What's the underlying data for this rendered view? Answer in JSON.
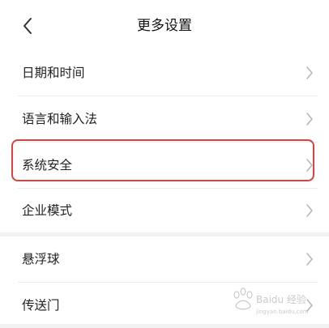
{
  "header": {
    "title": "更多设置",
    "back_icon": "chevron-left-icon"
  },
  "group1": {
    "items": [
      {
        "label": "日期和时间"
      },
      {
        "label": "语言和输入法"
      },
      {
        "label": "系统安全"
      },
      {
        "label": "企业模式"
      }
    ]
  },
  "group2": {
    "items": [
      {
        "label": "悬浮球"
      },
      {
        "label": "传送门"
      }
    ]
  },
  "highlight": {
    "target": "系统安全",
    "color": "#e0413a"
  },
  "watermark": {
    "text": "Baidu 经验",
    "url_text": "jingyan.baidu.com"
  },
  "colors": {
    "background": "#f2f2f2",
    "surface": "#ffffff",
    "text": "#222222",
    "chevron": "#b8b8b8"
  }
}
